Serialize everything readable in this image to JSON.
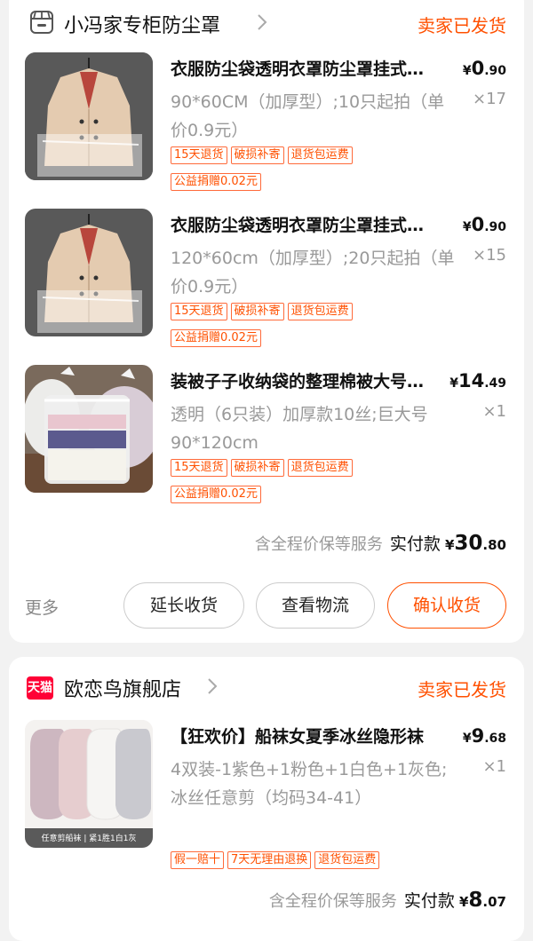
{
  "orders": [
    {
      "shop": {
        "name": "小冯家专柜防尘罩",
        "status": "卖家已发货"
      },
      "items": [
        {
          "title": "衣服防尘袋透明衣罩防尘罩挂式大衣套",
          "spec": "90*60CM（加厚型）;10只起拍（单价0.9元）",
          "price": {
            "currency": "¥",
            "integer": "0",
            "decimal": ".90"
          },
          "qty": "×17",
          "tags": [
            "15天退货",
            "破损补寄",
            "退货包运费",
            "公益捐赠0.02元"
          ]
        },
        {
          "title": "衣服防尘袋透明衣罩防尘罩挂式大衣套",
          "spec": "120*60cm（加厚型）;20只起拍（单价0.9元）",
          "price": {
            "currency": "¥",
            "integer": "0",
            "decimal": ".90"
          },
          "qty": "×15",
          "tags": [
            "15天退货",
            "破损补寄",
            "退货包运费",
            "公益捐赠0.02元"
          ]
        },
        {
          "title": "装被子子收纳袋的整理棉被大号袋子",
          "spec": "透明（6只装）加厚款10丝;巨大号90*120cm",
          "price": {
            "currency": "¥",
            "integer": "14",
            "decimal": ".49"
          },
          "qty": "×1",
          "tags": [
            "15天退货",
            "破损补寄",
            "退货包运费",
            "公益捐赠0.02元"
          ]
        }
      ],
      "summary": {
        "service": "含全程价保等服务",
        "paid_label": "实付款",
        "currency": "¥",
        "integer": "30",
        "decimal": ".80"
      },
      "actions": {
        "more": "更多",
        "extend": "延长收货",
        "logistics": "查看物流",
        "confirm": "确认收货"
      }
    },
    {
      "shop": {
        "name": "欧恋鸟旗舰店",
        "status": "卖家已发货",
        "badge": "天猫"
      },
      "items": [
        {
          "title": "【狂欢价】船袜女夏季冰丝隐形袜",
          "spec": "4双装-1紫色+1粉色+1白色+1灰色;冰丝任意剪（均码34-41）",
          "price": {
            "currency": "¥",
            "integer": "9",
            "decimal": ".68"
          },
          "qty": "×1",
          "tags": [
            "假一赔十",
            "7天无理由退换",
            "退货包运费"
          ],
          "thumb_caption": "任意剪船袜 | 紧1胜1白1灰"
        }
      ],
      "summary": {
        "service": "含全程价保等服务",
        "paid_label": "实付款",
        "currency": "¥",
        "integer": "8",
        "decimal": ".07"
      }
    }
  ],
  "colors": {
    "accent": "#ff5000",
    "muted": "#999999",
    "background": "#f2f2f2",
    "tmall": "#ff0036"
  }
}
